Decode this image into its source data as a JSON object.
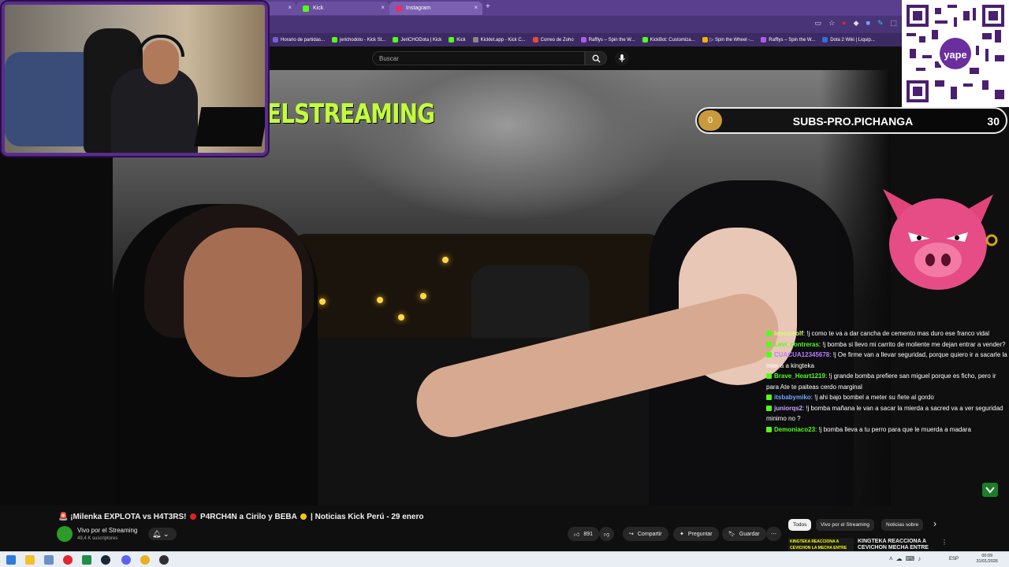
{
  "browser": {
    "tabs": [
      {
        "label": "",
        "favicon_color": "#6a4ea0"
      },
      {
        "label": "Kick",
        "favicon_color": "#53fc18"
      },
      {
        "label": "Instagram",
        "favicon_color": "#e1306c"
      }
    ],
    "new_tab_symbol": "+",
    "close_symbol": "×",
    "toolbar_icons": [
      "install-icon",
      "star-icon",
      "extension-icon",
      "extension-icon",
      "extension-icon",
      "extension-icon",
      "puzzle-icon"
    ],
    "bookmarks": [
      {
        "label": "Horario de partidas...",
        "color": "#7a5cd6"
      },
      {
        "label": "jerichodoto - Kick St...",
        "color": "#53fc18"
      },
      {
        "label": "JeriCHODota | Kick",
        "color": "#53fc18"
      },
      {
        "label": "Kick",
        "color": "#53fc18"
      },
      {
        "label": "Kicklet.app - Kick C...",
        "color": "#888888"
      },
      {
        "label": "Correo de Zoho",
        "color": "#e8483a"
      },
      {
        "label": "Rafflys – Spin the W...",
        "color": "#b05ce8"
      },
      {
        "label": "KickBot: Customiza...",
        "color": "#53fc18"
      },
      {
        "label": "▷ Spin the Wheel -...",
        "color": "#f0b400"
      },
      {
        "label": "Rafflys – Spin the W...",
        "color": "#b05ce8"
      },
      {
        "label": "Dota 2 Wiki | Liquip...",
        "color": "#2f6fd6"
      }
    ]
  },
  "youtube": {
    "search_placeholder": "Buscar"
  },
  "overlay": {
    "title_text": "ELSTREAMING",
    "title_color": "#c2ff3a",
    "goal": {
      "current": "0",
      "label": "SUBS-PRO.PICHANGA",
      "target": "30",
      "fill_fraction": 0.0
    }
  },
  "chat": {
    "messages": [
      {
        "user": "lenoxwolf",
        "color": "#d4ff70",
        "text": ": !j como te va a dar cancha de cemento mas duro ese franco vidal"
      },
      {
        "user": "Levi_contreras",
        "color": "#53fc18",
        "text": ": !j bomba si llevo mi carrito de moliente me dejan entrar a vender?"
      },
      {
        "user": "CUACUA12345678",
        "color": "#b77cff",
        "text": ": !j Oe firme van a llevar seguridad, porque quiero ir a sacarle la mier a a kingteka"
      },
      {
        "user": "Brave_Heart1219",
        "color": "#53fc18",
        "text": ": !j grande bomba prefiere san miguel porque es ficho, pero ir para Ate te paiteas cerdo marginal"
      },
      {
        "user": "itsbabymiko",
        "color": "#6fa8ff",
        "text": ": !j ahi bajo bombel a meter su ñete al gordo"
      },
      {
        "user": "juniorqs2",
        "color": "#c9a6ff",
        "text": ": !j bomba mañana le van a sacar la mierda a sacred va a ver seguridad minimo no ?"
      },
      {
        "user": "Demoniaco23",
        "color": "#53fc18",
        "text": ": !j bomba lleva a tu perro para que le muerda a madara"
      }
    ]
  },
  "video": {
    "title_prefix": "🚨 ¡Milenka EXPLOTA vs H4T3RS! ",
    "title_mid": " P4RCH4N a Cirilo y BEBA ",
    "title_suffix": " | Noticias Kick Perú - 29 enero",
    "channel": "Vivo por el Streaming",
    "subscribers": "49,4 K suscriptores",
    "likes": "891",
    "share_label": "Compartir",
    "ask_label": "Preguntar",
    "save_label": "Guardar",
    "more_symbol": "⋯"
  },
  "related": {
    "chips": [
      "Todos",
      "Vivo por el Streaming",
      "Noticias sobre"
    ],
    "next_symbol": "›",
    "item_thumb_text": "KINGTEKA REACCIONA A CEVICHON LA MECHA ENTRE MATTHEW Y FRED",
    "item_title": "KINGTEKA REACCIONA A CEVICHON MECHA ENTRE"
  },
  "taskbar": {
    "icons": [
      {
        "name": "windows-icon",
        "color": "#2f7bd8"
      },
      {
        "name": "file-explorer-icon",
        "color": "#f3c02c"
      },
      {
        "name": "settings-icon",
        "color": "#6d8fc7"
      },
      {
        "name": "opera-icon",
        "color": "#e2262e"
      },
      {
        "name": "excel-icon",
        "color": "#1f8e4a"
      },
      {
        "name": "steam-icon",
        "color": "#1b2838"
      },
      {
        "name": "discord-icon",
        "color": "#5865f2"
      },
      {
        "name": "chrome-icon",
        "color": "#e8b020"
      },
      {
        "name": "obs-icon",
        "color": "#303030"
      }
    ],
    "language": "ESP",
    "time": "00:09",
    "date": "31/01/2026"
  },
  "qr": {
    "brand": "yape"
  }
}
